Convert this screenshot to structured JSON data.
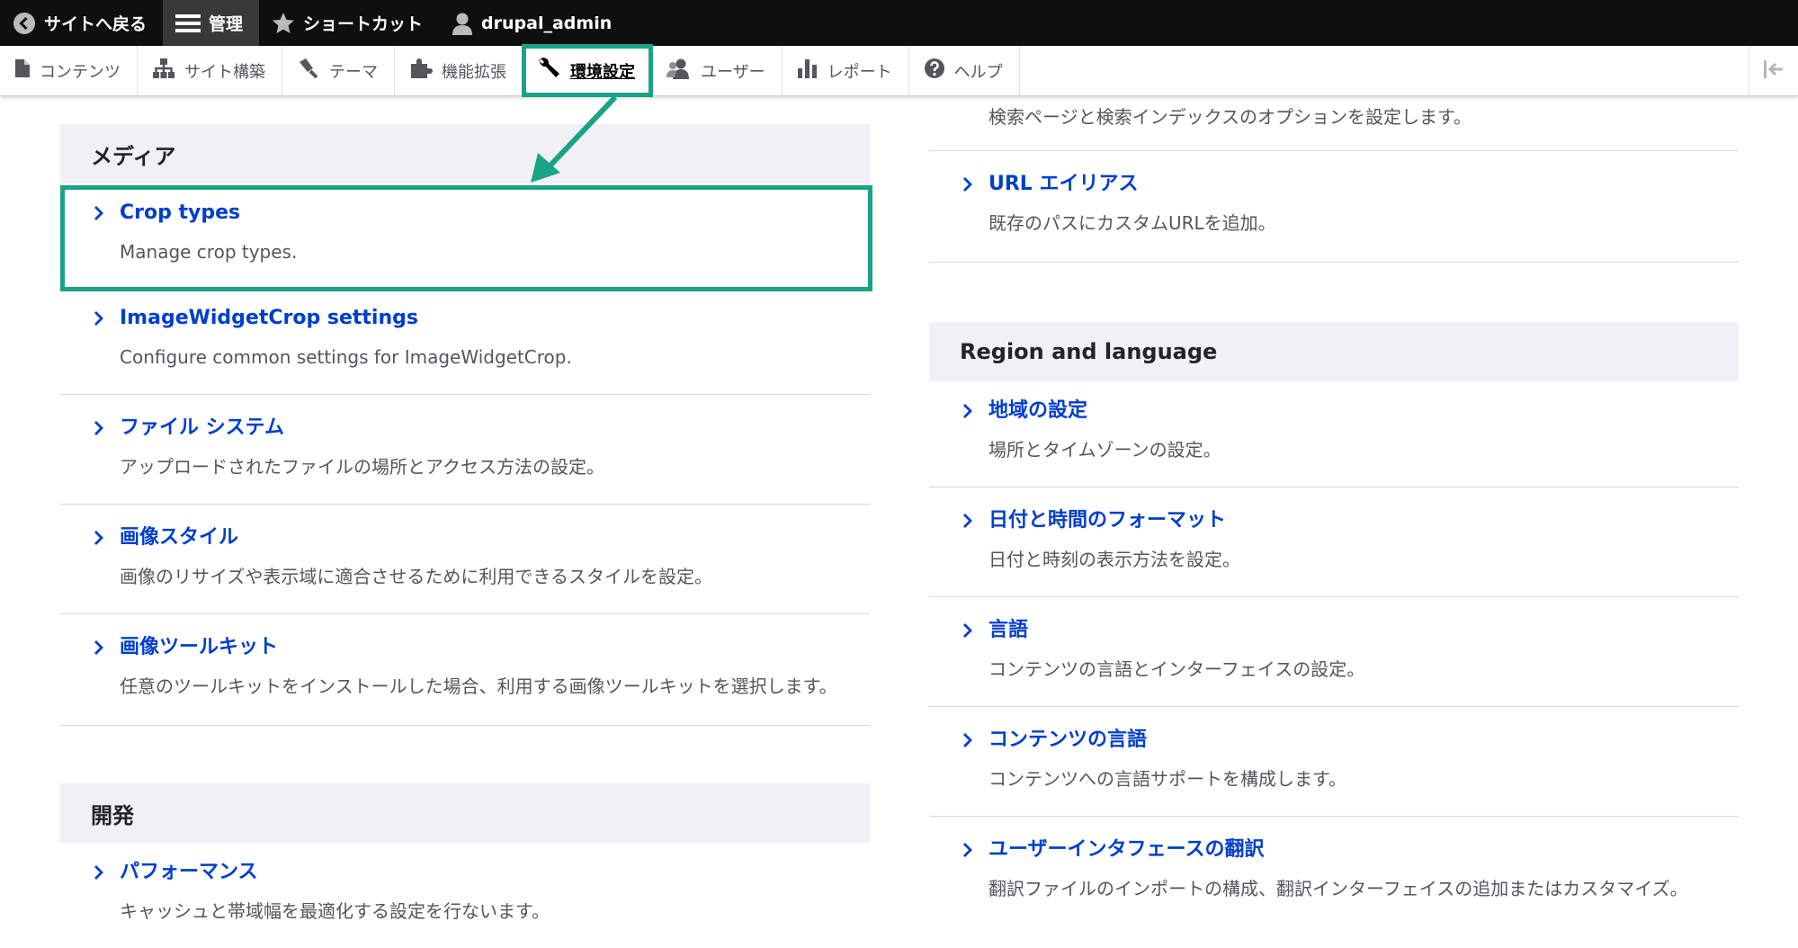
{
  "toolbar": {
    "back": "サイトへ戻る",
    "manage": "管理",
    "shortcuts": "ショートカット",
    "user": "drupal_admin"
  },
  "tray": {
    "items": [
      {
        "label": "コンテンツ",
        "icon": "file-icon"
      },
      {
        "label": "サイト構築",
        "icon": "structure-icon"
      },
      {
        "label": "テーマ",
        "icon": "paintbrush-icon"
      },
      {
        "label": "機能拡張",
        "icon": "puzzle-icon"
      },
      {
        "label": "環境設定",
        "icon": "wrench-icon"
      },
      {
        "label": "ユーザー",
        "icon": "people-icon"
      },
      {
        "label": "レポート",
        "icon": "bar-chart-icon"
      },
      {
        "label": "ヘルプ",
        "icon": "help-icon"
      }
    ],
    "current": "環境設定"
  },
  "left": {
    "media": {
      "title": "メディア",
      "entries": [
        {
          "label": "Crop types",
          "desc": "Manage crop types."
        },
        {
          "label": "ImageWidgetCrop settings",
          "desc": "Configure common settings for ImageWidgetCrop."
        },
        {
          "label": "ファイル システム",
          "desc": "アップロードされたファイルの場所とアクセス方法の設定。"
        },
        {
          "label": "画像スタイル",
          "desc": "画像のリサイズや表示域に適合させるために利用できるスタイルを設定。"
        },
        {
          "label": "画像ツールキット",
          "desc": "任意のツールキットをインストールした場合、利用する画像ツールキットを選択します。"
        }
      ]
    },
    "dev": {
      "title": "開発",
      "entries": [
        {
          "label": "パフォーマンス",
          "desc": "キャッシュと帯域幅を最適化する設定を行ないます。"
        }
      ]
    }
  },
  "right": {
    "top_desc": "検索ページと検索インデックスのオプションを設定します。",
    "url_alias": {
      "label": "URL エイリアス",
      "desc": "既存のパスにカスタムURLを追加。"
    },
    "region": {
      "title": "Region and language",
      "entries": [
        {
          "label": "地域の設定",
          "desc": "場所とタイムゾーンの設定。"
        },
        {
          "label": "日付と時間のフォーマット",
          "desc": "日付と時刻の表示方法を設定。"
        },
        {
          "label": "言語",
          "desc": "コンテンツの言語とインターフェイスの設定。"
        },
        {
          "label": "コンテンツの言語",
          "desc": "コンテンツへの言語サポートを構成します。"
        },
        {
          "label": "ユーザーインタフェースの翻訳",
          "desc": "翻訳ファイルのインポートの構成、翻訳インターフェイスの追加またはカスタマイズ。"
        }
      ]
    }
  },
  "colors": {
    "accent": "#1aa386",
    "link": "#003ecc",
    "toolbar": "#0f0f0f"
  }
}
